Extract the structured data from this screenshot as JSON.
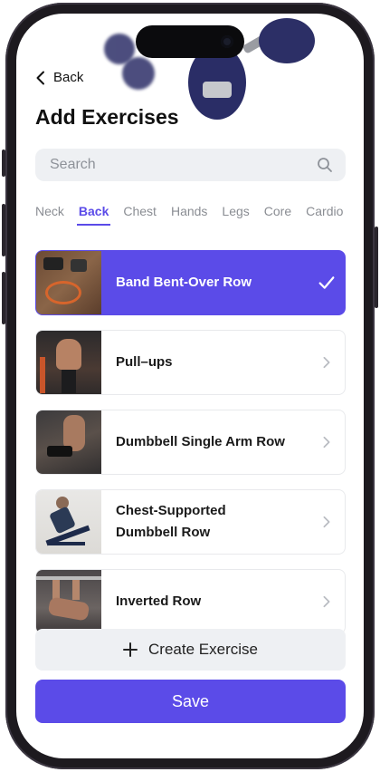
{
  "header": {
    "back_label": "Back",
    "title": "Add Exercises"
  },
  "search": {
    "placeholder": "Search"
  },
  "tabs": [
    {
      "label": "Neck"
    },
    {
      "label": "Back",
      "active": true
    },
    {
      "label": "Chest"
    },
    {
      "label": "Hands"
    },
    {
      "label": "Legs"
    },
    {
      "label": "Core"
    },
    {
      "label": "Cardio"
    }
  ],
  "exercises": [
    {
      "label": "Band Bent-Over Row",
      "selected": true
    },
    {
      "label": "Pull–ups"
    },
    {
      "label": "Dumbbell Single Arm Row"
    },
    {
      "label": "Chest-Supported Dumbbell Row"
    },
    {
      "label": "Inverted Row"
    }
  ],
  "actions": {
    "create_label": "Create Exercise",
    "save_label": "Save"
  },
  "colors": {
    "accent": "#5b4be8",
    "field_bg": "#eef0f3",
    "text": "#111111"
  }
}
